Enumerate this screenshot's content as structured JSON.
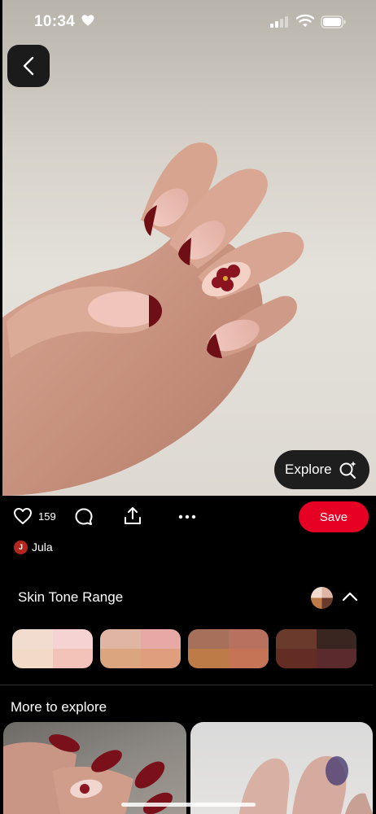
{
  "status_bar": {
    "time": "10:34"
  },
  "pin": {
    "explore_label": "Explore",
    "like_count": "159",
    "save_label": "Save",
    "creator_initial": "J",
    "creator_name": "Jula"
  },
  "skin_tone": {
    "title": "Skin Tone Range",
    "swatches": [
      {
        "colors": [
          "#f1dccf",
          "#f6d3d3",
          "#f3dac7",
          "#f3c2b9"
        ]
      },
      {
        "colors": [
          "#dfb6a3",
          "#e6a9a6",
          "#daa57f",
          "#df9f7f"
        ]
      },
      {
        "colors": [
          "#a6705a",
          "#b8705f",
          "#bd7b48",
          "#c57455"
        ]
      },
      {
        "colors": [
          "#6a3a2d",
          "#3a2620",
          "#632d23",
          "#5a2a2c"
        ]
      }
    ]
  },
  "more_to_explore": {
    "title": "More to explore"
  },
  "colors": {
    "accent": "#e60023",
    "background": "#000000",
    "nail_tip": "#6e0f16"
  }
}
